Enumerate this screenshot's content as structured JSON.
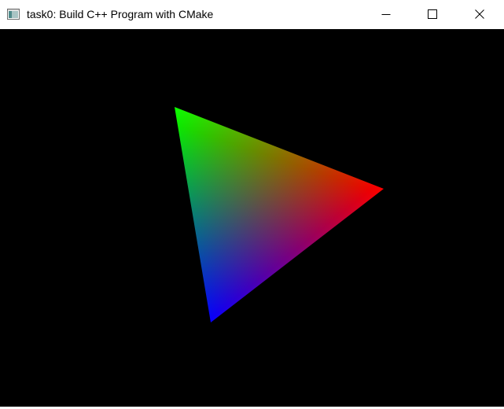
{
  "window": {
    "title": "task0: Build C++ Program with CMake",
    "app_icon": "application-window-icon",
    "controls": {
      "minimize_icon": "minimize-icon",
      "maximize_icon": "maximize-icon",
      "close_icon": "close-icon"
    }
  },
  "canvas": {
    "background": "#000000",
    "triangle": {
      "vertex_colors": {
        "top": "#00ff00",
        "right": "#ff0000",
        "bottom": "#0000ff"
      }
    }
  }
}
